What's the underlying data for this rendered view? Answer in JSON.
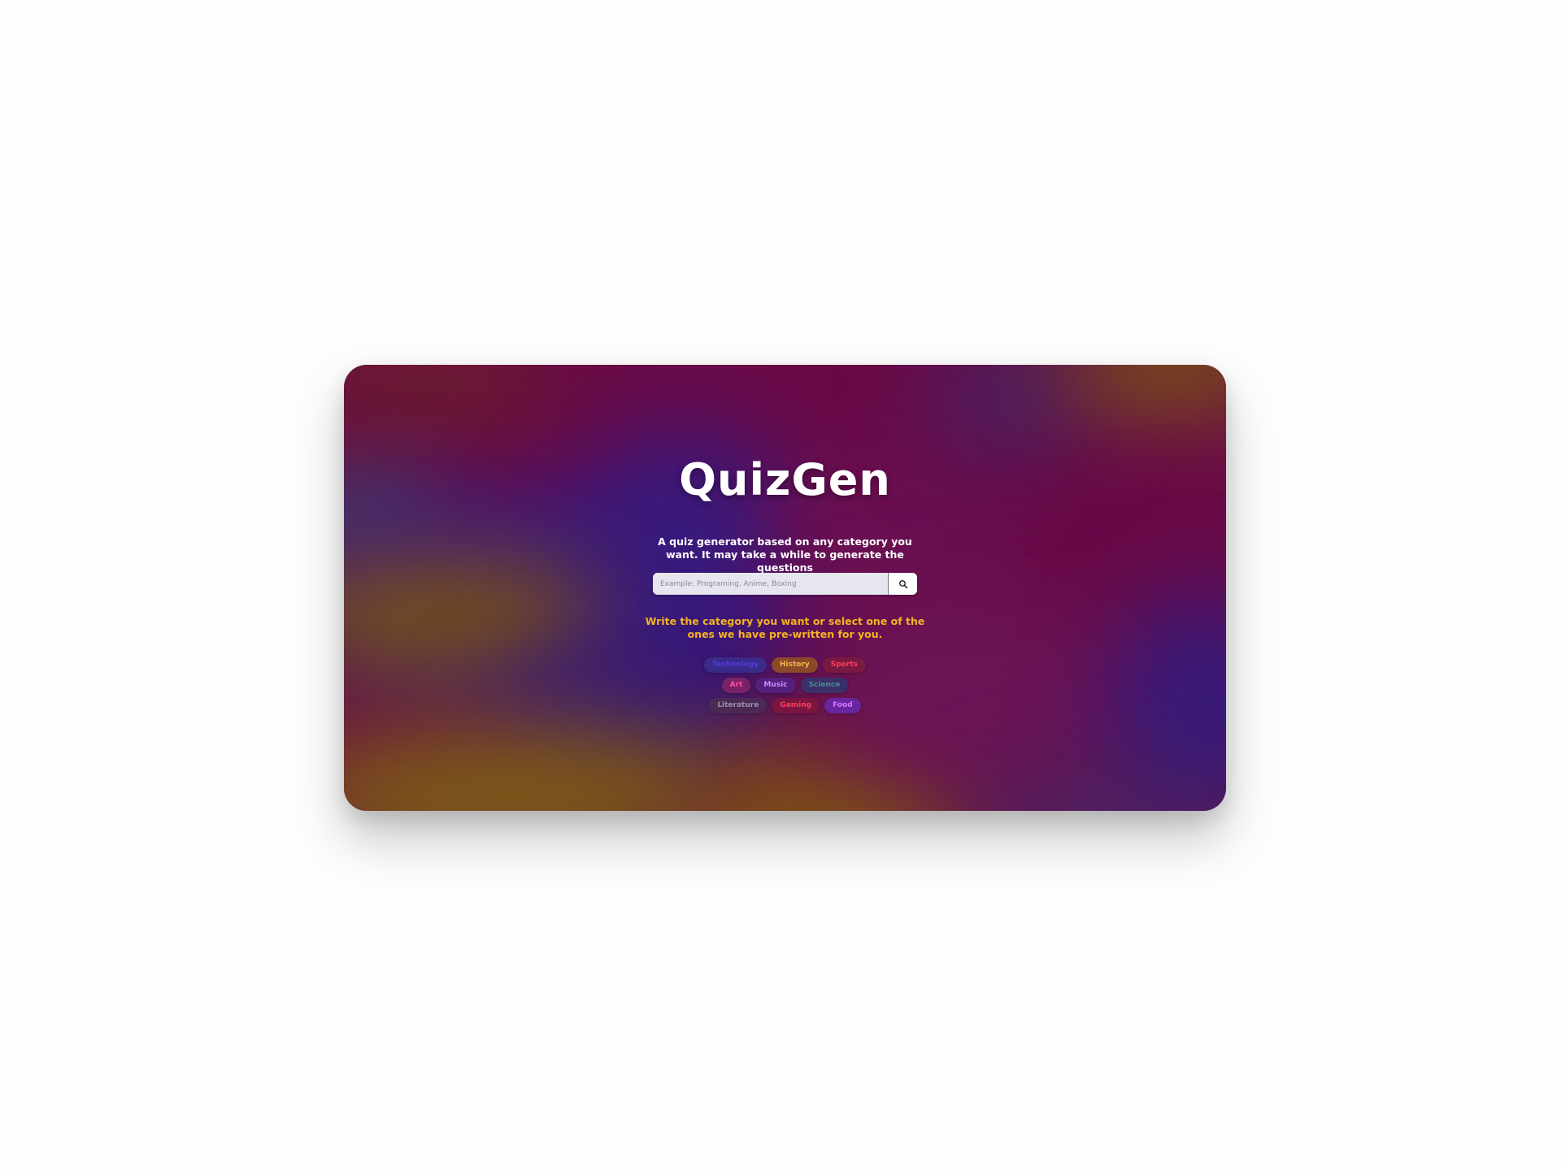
{
  "app": {
    "title": "QuizGen",
    "description": "A quiz generator based on any category you want. It may take a while to generate the questions"
  },
  "search": {
    "placeholder": "Example: Programing, Anime, Boxing",
    "value": "",
    "button_icon": "search-icon"
  },
  "hint": "Write the category you want or select one of the ones we have pre-written for you.",
  "categories": [
    {
      "label": "Technology",
      "color": "#4f3fd6",
      "bg": "#3a2a8a"
    },
    {
      "label": "History",
      "color": "#f3b54a",
      "bg": "#8a4a2a"
    },
    {
      "label": "Sports",
      "color": "#ff3b5c",
      "bg": "#7a1a40"
    },
    {
      "label": "Art",
      "color": "#ff4fa0",
      "bg": "#7a2266"
    },
    {
      "label": "Music",
      "color": "#c58cff",
      "bg": "#55207a"
    },
    {
      "label": "Science",
      "color": "#4a8a90",
      "bg": "#3b2f6a"
    },
    {
      "label": "Literature",
      "color": "#9a8fa8",
      "bg": "#4a2a55"
    },
    {
      "label": "Gaming",
      "color": "#ff3a5a",
      "bg": "#7a1540"
    },
    {
      "label": "Food",
      "color": "#d07aff",
      "bg": "#6a25a0"
    }
  ],
  "colors": {
    "title": "#ffffff",
    "hint": "#f5b320",
    "card_base": "#6a0a47"
  }
}
